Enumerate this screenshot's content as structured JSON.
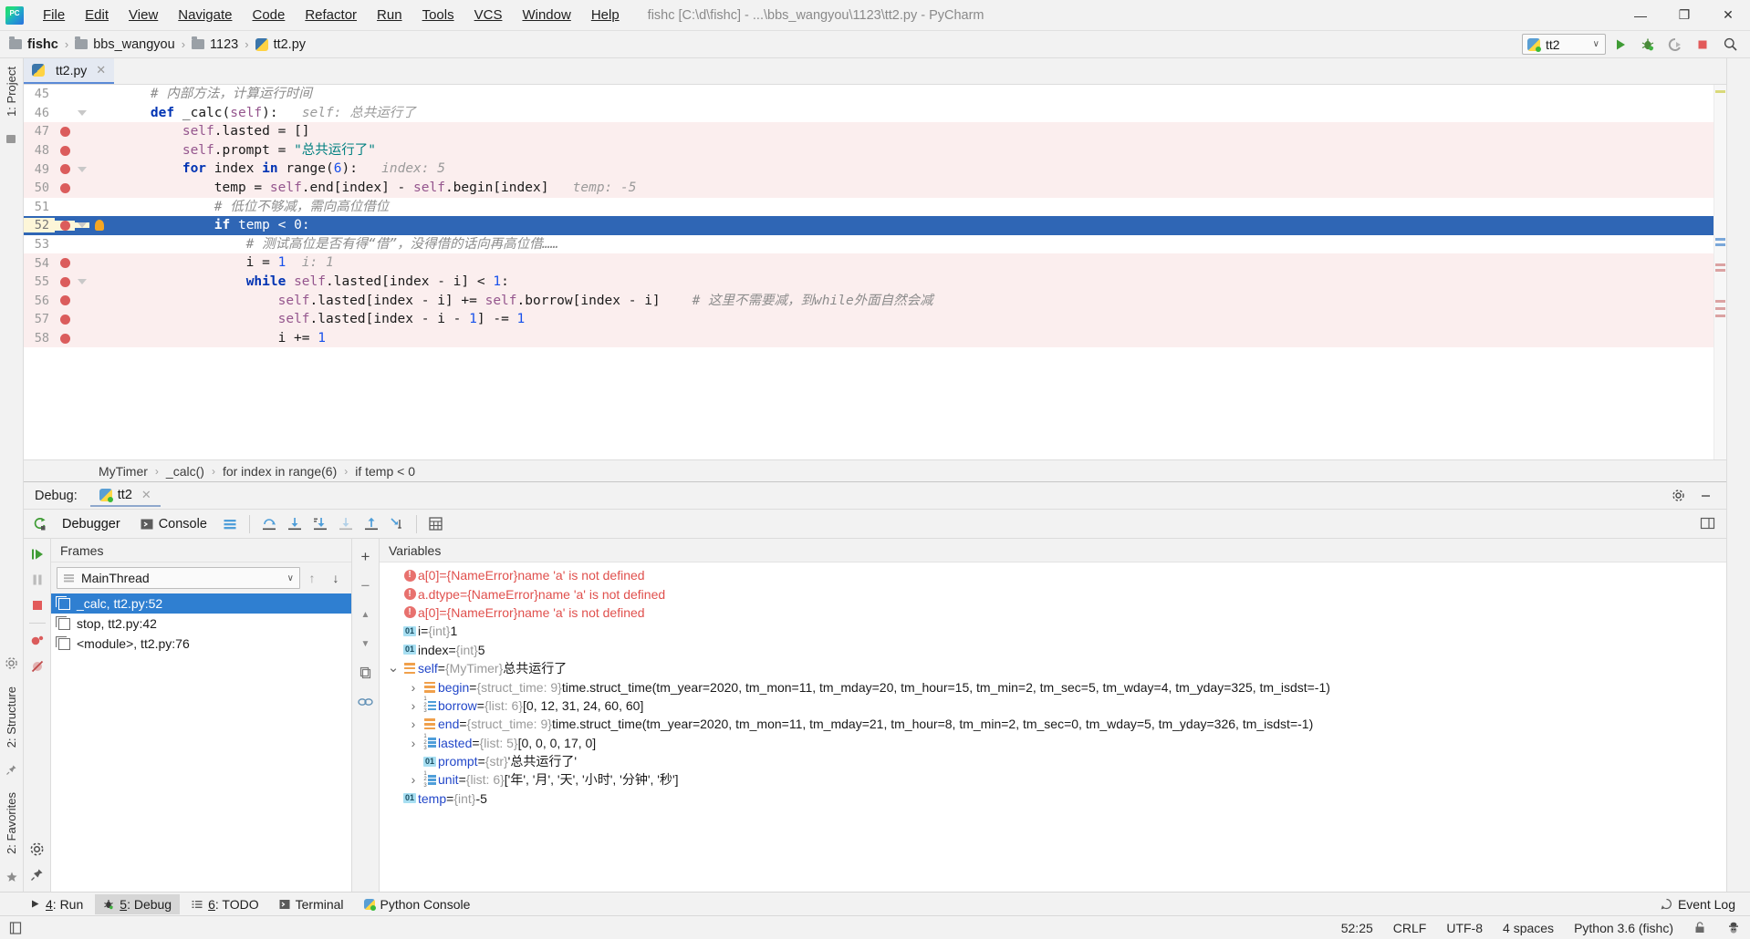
{
  "window": {
    "title": "fishc [C:\\d\\fishc] - ...\\bbs_wangyou\\1123\\tt2.py - PyCharm",
    "minimize": "—",
    "maximize": "❐",
    "close": "✕"
  },
  "menu": [
    {
      "label": "File"
    },
    {
      "label": "Edit"
    },
    {
      "label": "View"
    },
    {
      "label": "Navigate"
    },
    {
      "label": "Code"
    },
    {
      "label": "Refactor"
    },
    {
      "label": "Run"
    },
    {
      "label": "Tools"
    },
    {
      "label": "VCS"
    },
    {
      "label": "Window"
    },
    {
      "label": "Help"
    }
  ],
  "breadcrumb": {
    "items": [
      {
        "label": "fishc",
        "icon": "folder-icon"
      },
      {
        "label": "bbs_wangyou",
        "icon": "folder-icon"
      },
      {
        "label": "1123",
        "icon": "folder-icon"
      },
      {
        "label": "tt2.py",
        "icon": "python-file-icon"
      }
    ],
    "separator": "›"
  },
  "run_config": {
    "name": "tt2",
    "chevron": "∨"
  },
  "toolbar_right": {
    "run": "run-icon",
    "debug": "debug-icon",
    "coverage": "run-with-coverage-icon",
    "stop": "stop-icon",
    "search": "search-everywhere-icon"
  },
  "left_strip": {
    "project_tab": "1: Project",
    "structure_tab": "2: Structure",
    "favorites_tab": "2: Favorites"
  },
  "editor": {
    "tab": {
      "label": "tt2.py",
      "close": "✕"
    },
    "lines": [
      {
        "num": "45",
        "breakpoint": false,
        "fold": false,
        "exec": false,
        "current": false,
        "tokens": [
          {
            "t": "cmt",
            "v": "    # 内部方法，计算运行时间"
          }
        ]
      },
      {
        "num": "46",
        "breakpoint": false,
        "fold": true,
        "exec": false,
        "current": false,
        "tokens": [
          {
            "t": "p",
            "v": "    "
          },
          {
            "t": "kw",
            "v": "def"
          },
          {
            "t": "p",
            "v": " _calc("
          },
          {
            "t": "self",
            "v": "self"
          },
          {
            "t": "p",
            "v": "):"
          },
          {
            "t": "hint",
            "v": "   self: 总共运行了"
          }
        ]
      },
      {
        "num": "47",
        "breakpoint": true,
        "fold": false,
        "exec": true,
        "current": false,
        "tokens": [
          {
            "t": "p",
            "v": "        "
          },
          {
            "t": "self",
            "v": "self"
          },
          {
            "t": "p",
            "v": ".lasted = []"
          }
        ]
      },
      {
        "num": "48",
        "breakpoint": true,
        "fold": false,
        "exec": true,
        "current": false,
        "tokens": [
          {
            "t": "p",
            "v": "        "
          },
          {
            "t": "self",
            "v": "self"
          },
          {
            "t": "p",
            "v": ".prompt = "
          },
          {
            "t": "str",
            "v": "\"总共运行了\""
          }
        ]
      },
      {
        "num": "49",
        "breakpoint": true,
        "fold": true,
        "exec": true,
        "current": false,
        "tokens": [
          {
            "t": "p",
            "v": "        "
          },
          {
            "t": "kw",
            "v": "for"
          },
          {
            "t": "p",
            "v": " index "
          },
          {
            "t": "kw",
            "v": "in"
          },
          {
            "t": "p",
            "v": " range("
          },
          {
            "t": "num",
            "v": "6"
          },
          {
            "t": "p",
            "v": "):"
          },
          {
            "t": "hint",
            "v": "   index: 5"
          }
        ]
      },
      {
        "num": "50",
        "breakpoint": true,
        "fold": false,
        "exec": true,
        "current": false,
        "tokens": [
          {
            "t": "p",
            "v": "            temp = "
          },
          {
            "t": "self",
            "v": "self"
          },
          {
            "t": "p",
            "v": ".end[index] - "
          },
          {
            "t": "self",
            "v": "self"
          },
          {
            "t": "p",
            "v": ".begin[index]"
          },
          {
            "t": "hint",
            "v": "   temp: -5"
          }
        ]
      },
      {
        "num": "51",
        "breakpoint": false,
        "fold": false,
        "exec": false,
        "current": false,
        "tokens": [
          {
            "t": "cmt",
            "v": "            # 低位不够减，需向高位借位"
          }
        ]
      },
      {
        "num": "52",
        "breakpoint": true,
        "fold": true,
        "exec": false,
        "current": true,
        "bulb": true,
        "tokens": [
          {
            "t": "p",
            "v": "            "
          },
          {
            "t": "kw",
            "v": "if"
          },
          {
            "t": "p",
            "v": " temp < "
          },
          {
            "t": "num",
            "v": "0"
          },
          {
            "t": "p",
            "v": ":"
          }
        ]
      },
      {
        "num": "53",
        "breakpoint": false,
        "fold": false,
        "exec": false,
        "current": false,
        "tokens": [
          {
            "t": "cmt",
            "v": "                # 测试高位是否有得“借”，没得借的话向再高位借……"
          }
        ]
      },
      {
        "num": "54",
        "breakpoint": true,
        "fold": false,
        "exec": true,
        "current": false,
        "tokens": [
          {
            "t": "p",
            "v": "                i = "
          },
          {
            "t": "num",
            "v": "1"
          },
          {
            "t": "hint",
            "v": "  i: 1"
          }
        ]
      },
      {
        "num": "55",
        "breakpoint": true,
        "fold": true,
        "exec": true,
        "current": false,
        "tokens": [
          {
            "t": "p",
            "v": "                "
          },
          {
            "t": "kw",
            "v": "while"
          },
          {
            "t": "p",
            "v": " "
          },
          {
            "t": "self",
            "v": "self"
          },
          {
            "t": "p",
            "v": ".lasted[index - i] < "
          },
          {
            "t": "num",
            "v": "1"
          },
          {
            "t": "p",
            "v": ":"
          }
        ]
      },
      {
        "num": "56",
        "breakpoint": true,
        "fold": false,
        "exec": true,
        "current": false,
        "tokens": [
          {
            "t": "p",
            "v": "                    "
          },
          {
            "t": "self",
            "v": "self"
          },
          {
            "t": "p",
            "v": ".lasted[index - i] += "
          },
          {
            "t": "self",
            "v": "self"
          },
          {
            "t": "p",
            "v": ".borrow[index - i]"
          },
          {
            "t": "cmt",
            "v": "    # 这里不需要减，到while外面自然会减"
          }
        ]
      },
      {
        "num": "57",
        "breakpoint": true,
        "fold": false,
        "exec": true,
        "current": false,
        "tokens": [
          {
            "t": "p",
            "v": "                    "
          },
          {
            "t": "self",
            "v": "self"
          },
          {
            "t": "p",
            "v": ".lasted[index - i - "
          },
          {
            "t": "num",
            "v": "1"
          },
          {
            "t": "p",
            "v": "] -= "
          },
          {
            "t": "num",
            "v": "1"
          }
        ]
      },
      {
        "num": "58",
        "breakpoint": true,
        "fold": false,
        "exec": true,
        "current": false,
        "tokens": [
          {
            "t": "p",
            "v": "                    i += "
          },
          {
            "t": "num",
            "v": "1"
          }
        ]
      }
    ],
    "crumb": {
      "items": [
        "MyTimer",
        "_calc()",
        "for index in range(6)",
        "if temp < 0"
      ],
      "separator": "›"
    }
  },
  "debug": {
    "label": "Debug:",
    "tab": {
      "label": "tt2",
      "close": "✕"
    },
    "settings_icon": "gear-icon",
    "hide_icon": "minimize-icon",
    "toolbar": {
      "rerun": "rerun-icon",
      "debugger_tab": "Debugger",
      "console_tab": "Console",
      "layout_icon": "layout-icon",
      "step_over": "step-over-icon",
      "step_into": "step-into-icon",
      "force_step_into": "force-step-into-icon",
      "step_out_disabled": "step-out-disabled-icon",
      "step_out": "step-out-icon",
      "run_to_cursor": "run-to-cursor-icon",
      "evaluate": "evaluate-expression-icon",
      "restore_layout": "restore-layout-icon"
    },
    "side_actions": {
      "resume": "resume-program-icon",
      "pause": "pause-program-icon",
      "stop": "stop-icon",
      "view_breakpoints": "view-breakpoints-icon",
      "mute_breakpoints": "mute-breakpoints-icon",
      "settings": "settings-icon",
      "pin": "pin-icon"
    },
    "frames": {
      "title": "Frames",
      "thread": "MainThread",
      "thread_icon": "thread-icon",
      "chevron": "∨",
      "up": "↑",
      "down": "↓",
      "items": [
        {
          "label": "_calc, tt2.py:52",
          "selected": true
        },
        {
          "label": "stop, tt2.py:42",
          "selected": false
        },
        {
          "label": "<module>, tt2.py:76",
          "selected": false
        }
      ]
    },
    "variables": {
      "title": "Variables",
      "tools": {
        "add": "+",
        "remove": "−",
        "up": "▲",
        "down": "▼",
        "copy": "copy-icon",
        "watches": "watches-icon"
      },
      "rows": [
        {
          "arrow": "",
          "icon": "error",
          "name": "a[0]",
          "eq": " = ",
          "type": "",
          "value": "{NameError}name 'a' is not defined",
          "error": true,
          "indent": 0
        },
        {
          "arrow": "",
          "icon": "error",
          "name": "a.dtype",
          "eq": " = ",
          "type": "",
          "value": "{NameError}name 'a' is not defined",
          "error": true,
          "indent": 0
        },
        {
          "arrow": "",
          "icon": "error",
          "name": "a[0]",
          "eq": " = ",
          "type": "",
          "value": "{NameError}name 'a' is not defined",
          "error": true,
          "indent": 0
        },
        {
          "arrow": "",
          "icon": "num",
          "name": "i",
          "eq": " = ",
          "type": "{int}",
          "value": "1",
          "error": false,
          "indent": 0
        },
        {
          "arrow": "",
          "icon": "num",
          "name": "index",
          "eq": " = ",
          "type": "{int}",
          "value": "5",
          "error": false,
          "indent": 0
        },
        {
          "arrow": "expanded",
          "icon": "obj",
          "name": "self",
          "eq": " = ",
          "type": "{MyTimer}",
          "value": "总共运行了",
          "error": false,
          "indent": 0,
          "nameblue": true
        },
        {
          "arrow": "collapsed",
          "icon": "obj",
          "name": "begin",
          "eq": " = ",
          "type": "{struct_time: 9}",
          "value": "time.struct_time(tm_year=2020, tm_mon=11, tm_mday=20, tm_hour=15, tm_min=2, tm_sec=5, tm_wday=4, tm_yday=325, tm_isdst=-1)",
          "error": false,
          "indent": 1,
          "nameblue": true
        },
        {
          "arrow": "collapsed",
          "icon": "list",
          "name": "borrow",
          "eq": " = ",
          "type": "{list: 6}",
          "value": "[0, 12, 31, 24, 60, 60]",
          "error": false,
          "indent": 1,
          "nameblue": true
        },
        {
          "arrow": "collapsed",
          "icon": "obj",
          "name": "end",
          "eq": " = ",
          "type": "{struct_time: 9}",
          "value": "time.struct_time(tm_year=2020, tm_mon=11, tm_mday=21, tm_hour=8, tm_min=2, tm_sec=0, tm_wday=5, tm_yday=326, tm_isdst=-1)",
          "error": false,
          "indent": 1,
          "nameblue": true
        },
        {
          "arrow": "collapsed",
          "icon": "list",
          "name": "lasted",
          "eq": " = ",
          "type": "{list: 5}",
          "value": "[0, 0, 0, 17, 0]",
          "error": false,
          "indent": 1,
          "nameblue": true
        },
        {
          "arrow": "",
          "icon": "num",
          "name": "prompt",
          "eq": " = ",
          "type": "{str}",
          "value": "'总共运行了'",
          "error": false,
          "indent": 1,
          "nameblue": true
        },
        {
          "arrow": "collapsed",
          "icon": "list",
          "name": "unit",
          "eq": " = ",
          "type": "{list: 6}",
          "value": "['年', '月', '天', '小时', '分钟', '秒']",
          "error": false,
          "indent": 1,
          "nameblue": true
        },
        {
          "arrow": "",
          "icon": "num",
          "name": "temp",
          "eq": " = ",
          "type": "{int}",
          "value": "-5",
          "error": false,
          "indent": 0,
          "nameblue": true
        }
      ]
    }
  },
  "toolwindow_bar": {
    "items": [
      {
        "label": "4: Run",
        "mnemonic": "4",
        "rest": ": Run",
        "icon": "run-icon",
        "active": false
      },
      {
        "label": "5: Debug",
        "mnemonic": "5",
        "rest": ": Debug",
        "icon": "debug-icon",
        "active": true
      },
      {
        "label": "6: TODO",
        "mnemonic": "6",
        "rest": ": TODO",
        "icon": "todo-icon",
        "active": false
      },
      {
        "label": "Terminal",
        "mnemonic": "",
        "rest": "Terminal",
        "icon": "terminal-icon",
        "active": false
      },
      {
        "label": "Python Console",
        "mnemonic": "",
        "rest": "Python Console",
        "icon": "python-icon",
        "active": false
      }
    ],
    "event_log": "Event Log"
  },
  "statusbar": {
    "caret": "52:25",
    "line_sep": "CRLF",
    "encoding": "UTF-8",
    "indent": "4 spaces",
    "interpreter": "Python 3.6 (fishc)",
    "lock_icon": "lock-icon",
    "inspector_icon": "hector-icon"
  },
  "colors": {
    "accent_blue": "#2f66b5",
    "selection_blue": "#2f7fd1",
    "exec_pink": "#fbeeee",
    "breakpoint_red": "#db5c5c",
    "error_red": "#e0504d"
  }
}
